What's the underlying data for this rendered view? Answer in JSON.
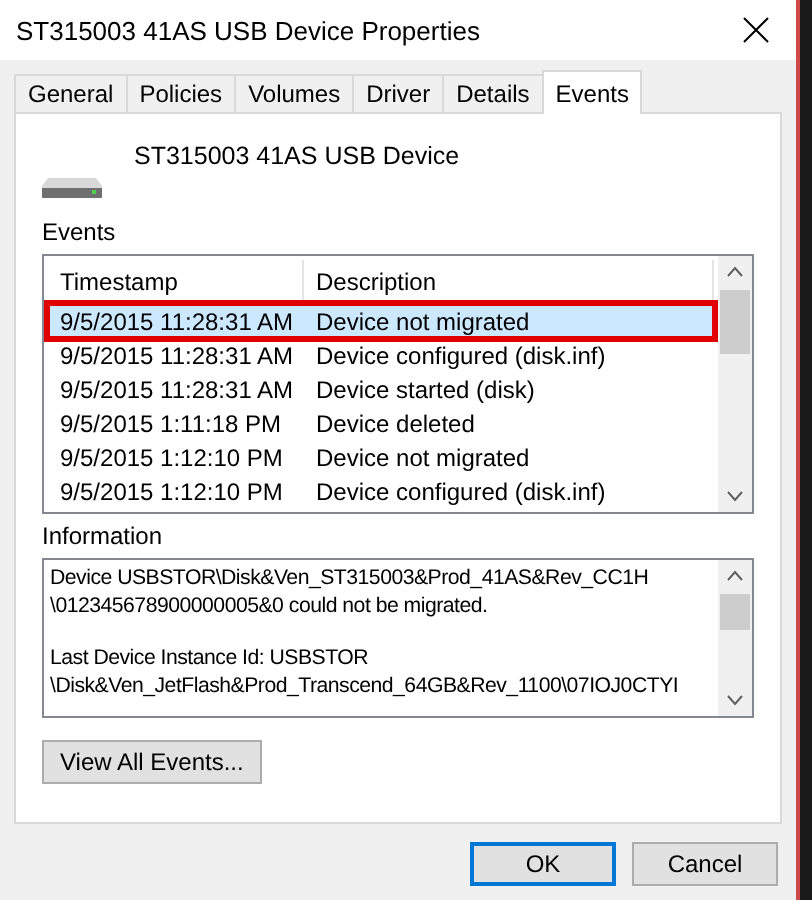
{
  "window": {
    "title": "ST315003 41AS USB Device Properties"
  },
  "tabs": [
    {
      "label": "General",
      "selected": false
    },
    {
      "label": "Policies",
      "selected": false
    },
    {
      "label": "Volumes",
      "selected": false
    },
    {
      "label": "Driver",
      "selected": false
    },
    {
      "label": "Details",
      "selected": false
    },
    {
      "label": "Events",
      "selected": true
    }
  ],
  "device": {
    "name": "ST315003 41AS USB Device"
  },
  "events": {
    "label": "Events",
    "columns": [
      "Timestamp",
      "Description"
    ],
    "rows": [
      {
        "timestamp": "9/5/2015 11:28:31 AM",
        "description": "Device not migrated",
        "selected": true,
        "highlighted": true
      },
      {
        "timestamp": "9/5/2015 11:28:31 AM",
        "description": "Device configured (disk.inf)",
        "selected": false,
        "highlighted": false
      },
      {
        "timestamp": "9/5/2015 11:28:31 AM",
        "description": "Device started (disk)",
        "selected": false,
        "highlighted": false
      },
      {
        "timestamp": "9/5/2015 1:11:18 PM",
        "description": "Device deleted",
        "selected": false,
        "highlighted": false
      },
      {
        "timestamp": "9/5/2015 1:12:10 PM",
        "description": "Device not migrated",
        "selected": false,
        "highlighted": false
      },
      {
        "timestamp": "9/5/2015 1:12:10 PM",
        "description": "Device configured (disk.inf)",
        "selected": false,
        "highlighted": false
      }
    ]
  },
  "information": {
    "label": "Information",
    "paragraphs": [
      [
        "Device USBSTOR\\Disk&Ven_ST315003&Prod_41AS&Rev_CC1H",
        "\\012345678900000005&0 could not be migrated."
      ],
      [
        "Last Device Instance Id: USBSTOR",
        "\\Disk&Ven_JetFlash&Prod_Transcend_64GB&Rev_1100\\07IOJ0CTYI"
      ]
    ]
  },
  "view_all_button": "View All Events...",
  "buttons": [
    {
      "label": "OK",
      "default": true
    },
    {
      "label": "Cancel",
      "default": false
    }
  ]
}
